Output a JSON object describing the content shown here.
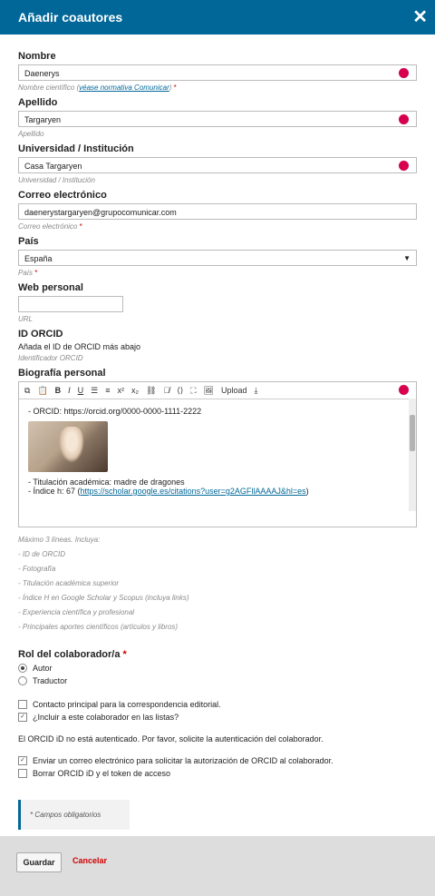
{
  "header": {
    "title": "Añadir coautores",
    "close_icon": "close-icon"
  },
  "fields": {
    "nombre": {
      "label": "Nombre",
      "value": "Daenerys",
      "help_prefix": "Nombre científico (",
      "help_link": "véase normativa Comunicar",
      "help_suffix": ")",
      "required": "*"
    },
    "apellido": {
      "label": "Apellido",
      "value": "Targaryen",
      "help": "Apellido"
    },
    "universidad": {
      "label": "Universidad / Institución",
      "value": "Casa Targaryen",
      "help": "Universidad / Institución"
    },
    "correo": {
      "label": "Correo electrónico",
      "value": "daenerystargaryen@grupocomunicar.com",
      "help": "Correo electrónico",
      "required": "*"
    },
    "pais": {
      "label": "País",
      "value": "España",
      "help": "País",
      "required": "*"
    },
    "web": {
      "label": "Web personal",
      "value": "",
      "help": "URL"
    },
    "orcid": {
      "label": "ID ORCID",
      "text": "Añada el ID de ORCID más abajo",
      "help": "Identificador ORCID"
    },
    "biografia": {
      "label": "Biografía personal",
      "toolbar": {
        "upload": "Upload"
      },
      "lines": {
        "line1": "- ORCID: https://orcid.org/0000-0000-1111-2222",
        "line2": "- Titulación académica: madre de dragones",
        "line3_prefix": "- Índice h: 67 (",
        "line3_link": "https://scholar.google.es/citations?user=g2AGFllAAAAJ&hl=es",
        "line3_suffix": ")"
      },
      "guide": [
        "Máximo 3 líneas. Incluya:",
        "- ID de ORCID",
        "- Fotografía",
        "- Titulación académica superior",
        "- Índice H en Google Scholar y Scopus (incluya links)",
        "- Experiencia científica y profesional",
        "- Principales aportes científicos (artículos y libros)"
      ]
    }
  },
  "rol": {
    "label": "Rol del colaborador/a",
    "required": "*",
    "options": {
      "autor": "Autor",
      "traductor": "Traductor"
    },
    "selected": "Autor"
  },
  "checks": {
    "contacto": {
      "label": "Contacto principal para la correspondencia editorial.",
      "checked": false
    },
    "incluir": {
      "label": "¿Incluir a este colaborador en las listas?",
      "checked": true
    }
  },
  "orcid_notice": "El ORCID iD no está autenticado. Por favor, solicite la autenticación del colaborador.",
  "orcid_actions": {
    "enviar": {
      "label": "Enviar un correo electrónico para solicitar la autorización de ORCID al colaborador.",
      "checked": true
    },
    "borrar": {
      "label": "Borrar ORCID iD y el token de acceso",
      "checked": false
    }
  },
  "required_note": "* Campos obligatorios",
  "footer": {
    "save": "Guardar",
    "cancel": "Cancelar"
  }
}
